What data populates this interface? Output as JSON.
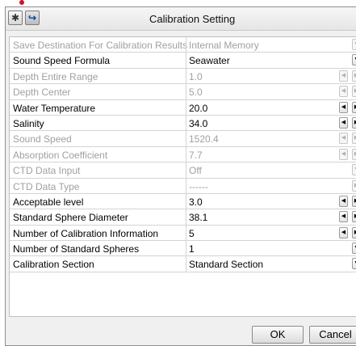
{
  "window": {
    "title": "Calibration Setting"
  },
  "toolbar": {
    "settings_icon": "gear-icon",
    "exit_icon": "exit-arrow-icon",
    "settings_glyph": "✱",
    "exit_glyph": "↪"
  },
  "controls": {
    "dec": "◀",
    "inc": "▶",
    "drop": "▼"
  },
  "rows": [
    {
      "label": "Save Destination For Calibration Results",
      "value": "Internal Memory",
      "enabled": false,
      "control": "dropdown"
    },
    {
      "label": "Sound Speed Formula",
      "value": "Seawater",
      "enabled": true,
      "control": "dropdown"
    },
    {
      "label": "Depth Entire Range",
      "value": "1.0",
      "enabled": false,
      "control": "stepper"
    },
    {
      "label": "Depth Center",
      "value": "5.0",
      "enabled": false,
      "control": "stepper"
    },
    {
      "label": "Water Temperature",
      "value": "20.0",
      "enabled": true,
      "control": "stepper"
    },
    {
      "label": "Salinity",
      "value": "34.0",
      "enabled": true,
      "control": "stepper"
    },
    {
      "label": "Sound Speed",
      "value": "1520.4",
      "enabled": false,
      "control": "stepper"
    },
    {
      "label": "Absorption Coefficient",
      "value": "7.7",
      "enabled": false,
      "control": "stepper"
    },
    {
      "label": "CTD Data Input",
      "value": "Off",
      "enabled": false,
      "control": "dropdown"
    },
    {
      "label": "CTD Data Type",
      "value": "------",
      "enabled": false,
      "control": "arrow"
    },
    {
      "label": "Acceptable level",
      "value": "3.0",
      "enabled": true,
      "control": "stepper"
    },
    {
      "label": "Standard Sphere Diameter",
      "value": "38.1",
      "enabled": true,
      "control": "stepper"
    },
    {
      "label": "Number of Calibration Information",
      "value": "5",
      "enabled": true,
      "control": "stepper"
    },
    {
      "label": "Number of Standard Spheres",
      "value": "1",
      "enabled": true,
      "control": "dropdown"
    },
    {
      "label": "Calibration Section",
      "value": "Standard Section",
      "enabled": true,
      "control": "dropdown"
    }
  ],
  "buttons": {
    "ok": "OK",
    "cancel": "Cancel"
  },
  "colors": {
    "disabled_text": "#a0a0a0",
    "marker": "#d0102a"
  }
}
